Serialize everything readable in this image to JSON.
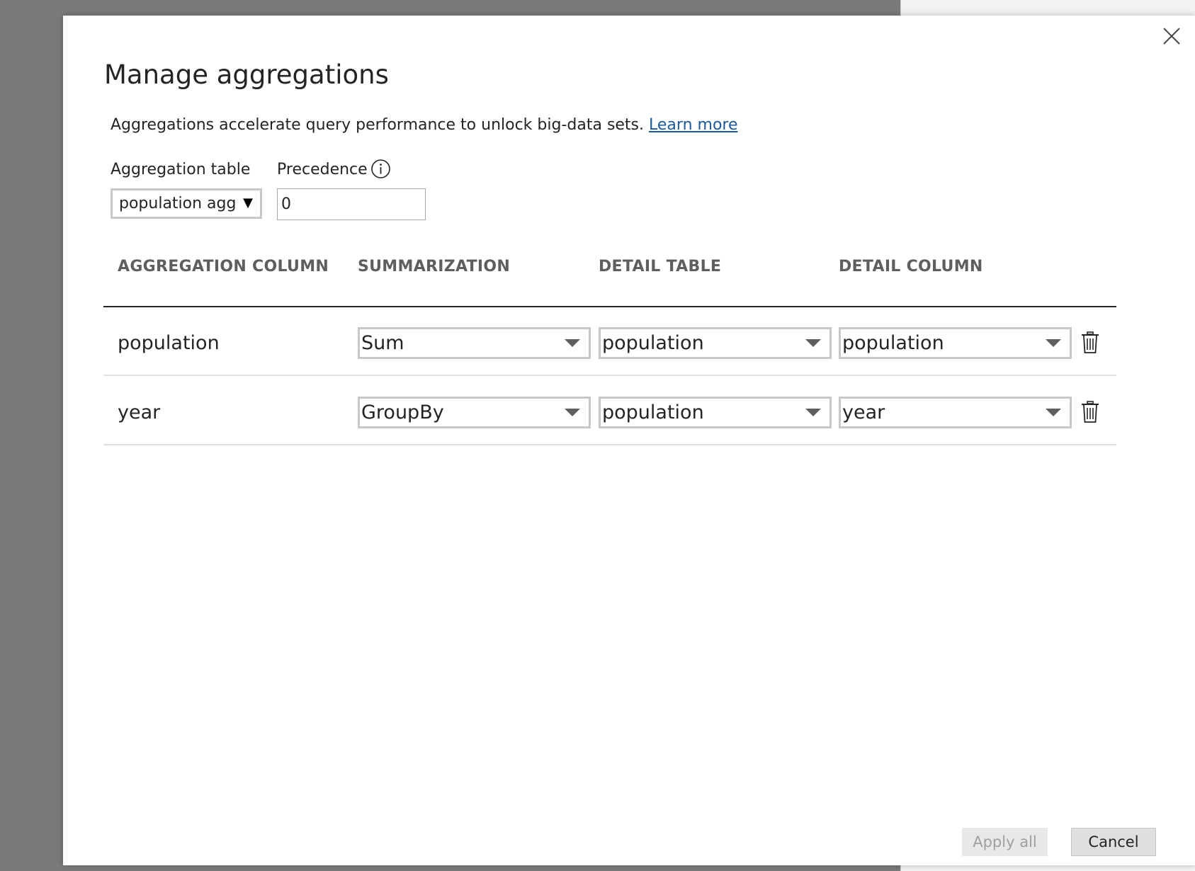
{
  "dialog": {
    "title": "Manage aggregations",
    "description": "Aggregations accelerate query performance to unlock big-data sets.",
    "learn_more": "Learn more",
    "aggregation_table_label": "Aggregation table",
    "aggregation_table_value": "population agg",
    "precedence_label": "Precedence",
    "precedence_value": "0"
  },
  "table": {
    "headers": [
      "AGGREGATION COLUMN",
      "SUMMARIZATION",
      "DETAIL TABLE",
      "DETAIL COLUMN"
    ],
    "rows": [
      {
        "aggregation_column": "population",
        "summarization": "Sum",
        "detail_table": "population",
        "detail_column": "population"
      },
      {
        "aggregation_column": "year",
        "summarization": "GroupBy",
        "detail_table": "population",
        "detail_column": "year"
      }
    ]
  },
  "footer": {
    "apply_all": "Apply all",
    "cancel": "Cancel"
  },
  "icons": {
    "close": "close-icon",
    "info": "info-icon",
    "delete": "trash-icon",
    "dropdown": "caret-down-icon"
  },
  "colors": {
    "link": "#1c5a9c",
    "overlay": "#7a7a7a",
    "header_text": "#605e5c"
  }
}
